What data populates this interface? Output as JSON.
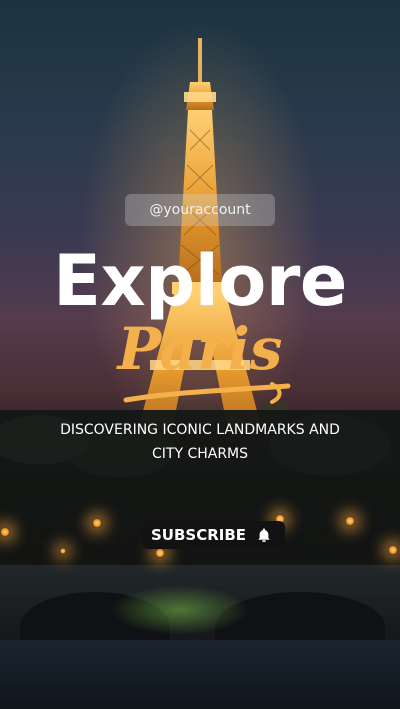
{
  "post": {
    "handle": "@youraccount",
    "title": "Explore",
    "script_word": "Paris",
    "subtitle_line1": "DISCOVERING ICONIC LANDMARKS AND",
    "subtitle_line2": "CITY CHARMS",
    "subscribe_label": "SUBSCRIBE",
    "subscribe_icon": "bell-icon"
  },
  "colors": {
    "title": "#ffffff",
    "script": "#f4b04a",
    "handle_bg": "rgba(210,215,222,0.30)",
    "button_bg": "#121212"
  }
}
